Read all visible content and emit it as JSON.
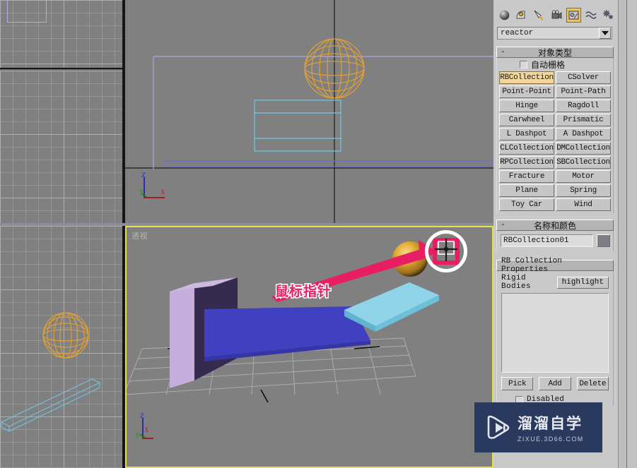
{
  "app": {
    "name": "3ds Max reactor command panel"
  },
  "command_panel": {
    "icons": [
      {
        "name": "create-icon",
        "glyph": "sphere"
      },
      {
        "name": "modify-icon",
        "glyph": "bend"
      },
      {
        "name": "hierarchy-icon",
        "glyph": "pivot"
      },
      {
        "name": "motion-icon",
        "glyph": "camera"
      },
      {
        "name": "display-icon",
        "glyph": "display",
        "active": true
      },
      {
        "name": "utilities-icon",
        "glyph": "wave"
      },
      {
        "name": "extras-icon",
        "glyph": "gears"
      }
    ],
    "dropdown": {
      "value": "reactor"
    },
    "object_type": {
      "title": "对象类型",
      "collapse": "-",
      "auto_grid_label": "自动栅格",
      "auto_grid_checked": false,
      "buttons": [
        {
          "label": "RBCollection",
          "selected": true
        },
        {
          "label": "CSolver",
          "selected": false
        },
        {
          "label": "Point-Point",
          "selected": false
        },
        {
          "label": "Point-Path",
          "selected": false
        },
        {
          "label": "Hinge",
          "selected": false
        },
        {
          "label": "Ragdoll",
          "selected": false
        },
        {
          "label": "Carwheel",
          "selected": false
        },
        {
          "label": "Prismatic",
          "selected": false
        },
        {
          "label": "L Dashpot",
          "selected": false
        },
        {
          "label": "A Dashpot",
          "selected": false
        },
        {
          "label": "CLCollection",
          "selected": false
        },
        {
          "label": "DMCollection",
          "selected": false
        },
        {
          "label": "RPCollection",
          "selected": false
        },
        {
          "label": "SBCollection",
          "selected": false
        },
        {
          "label": "Fracture",
          "selected": false
        },
        {
          "label": "Motor",
          "selected": false
        },
        {
          "label": "Plane",
          "selected": false
        },
        {
          "label": "Spring",
          "selected": false
        },
        {
          "label": "Toy Car",
          "selected": false
        },
        {
          "label": "Wind",
          "selected": false
        }
      ]
    },
    "name_and_color": {
      "title": "名称和颜色",
      "collapse": "-",
      "object_name": "RBCollection01",
      "color": "#7e7e86"
    },
    "rb_collection_properties": {
      "title": "RB Collection Properties",
      "rigid_bodies_label": "Rigid Bodies",
      "highlight_label": "highlight",
      "list_items": [],
      "pick_label": "Pick",
      "add_label": "Add",
      "delete_label": "Delete",
      "disabled_label": "Disabled"
    }
  },
  "viewports": {
    "perspective": {
      "label": "透视",
      "active": true,
      "border_color": "#e2e24a",
      "axis": {
        "z": "Z",
        "x": "X",
        "y": "Y"
      }
    },
    "top": {
      "label": "",
      "axis": {
        "z": "Z",
        "x": "X",
        "y": "Y"
      }
    },
    "left_top": {
      "label": ""
    },
    "left_mid": {
      "label": ""
    },
    "left_bottom": {
      "label": ""
    }
  },
  "annotation": {
    "text": "鼠标指针",
    "text_color": "#e81e64",
    "outline_color": "#ffffff",
    "arrow_color": "#e81e64",
    "cursor_icon": "select-crosshair-cursor"
  },
  "watermark": {
    "title": "溜溜自学",
    "subtitle": "ZIXUE.3D66.COM",
    "logo_icon": "play-button-logo",
    "background": "#2a3a5e"
  }
}
